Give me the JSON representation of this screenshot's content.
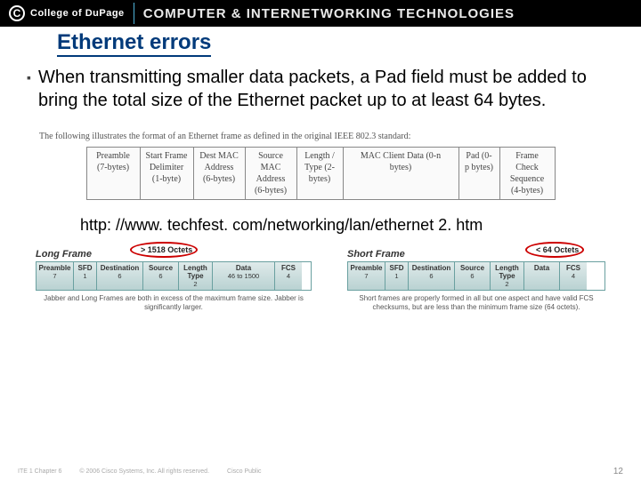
{
  "header": {
    "logo_letter": "C",
    "college": "College of DuPage",
    "title": "COMPUTER & INTERNETWORKING TECHNOLOGIES"
  },
  "slide": {
    "title": "Ethernet errors",
    "bullet": "When transmitting smaller data packets, a Pad field must be added to bring the total size of the Ethernet packet up to at least 64 bytes."
  },
  "frame": {
    "caption": "The following illustrates the format of an Ethernet frame as defined in the original IEEE 802.3 standard:",
    "cells": [
      "Preamble (7-bytes)",
      "Start Frame Delimiter (1-byte)",
      "Dest MAC Address (6-bytes)",
      "Source MAC Address (6-bytes)",
      "Length / Type (2-bytes)",
      "MAC Client Data (0-n bytes)",
      "Pad (0-p bytes)",
      "Frame Check Sequence (4-bytes)"
    ]
  },
  "link": "http: //www. techfest. com/networking/lan/ethernet 2. htm",
  "long_frame": {
    "title": "Long Frame",
    "oval_label": "> 1518 Octets",
    "segments": [
      {
        "h": "Preamble",
        "s": "7"
      },
      {
        "h": "SFD",
        "s": "1"
      },
      {
        "h": "Destination",
        "s": "6"
      },
      {
        "h": "Source",
        "s": "6"
      },
      {
        "h": "Length Type",
        "s": "2"
      },
      {
        "h": "Data",
        "s": "46 to 1500"
      },
      {
        "h": "FCS",
        "s": "4"
      }
    ],
    "caption": "Jabber and Long Frames are both in excess of the maximum frame size. Jabber is significantly larger."
  },
  "short_frame": {
    "title": "Short Frame",
    "oval_label": "< 64 Octets",
    "segments": [
      {
        "h": "Preamble",
        "s": "7"
      },
      {
        "h": "SFD",
        "s": "1"
      },
      {
        "h": "Destination",
        "s": "6"
      },
      {
        "h": "Source",
        "s": "6"
      },
      {
        "h": "Length Type",
        "s": "2"
      },
      {
        "h": "Data",
        "s": ""
      },
      {
        "h": "FCS",
        "s": "4"
      }
    ],
    "caption": "Short frames are properly formed in all but one aspect and have valid FCS checksums, but are less than the minimum frame size (64 octets)."
  },
  "footer": {
    "left": "ITE 1 Chapter 6",
    "copyright": "© 2006 Cisco Systems, Inc. All rights reserved.",
    "public": "Cisco Public",
    "page": "12"
  }
}
